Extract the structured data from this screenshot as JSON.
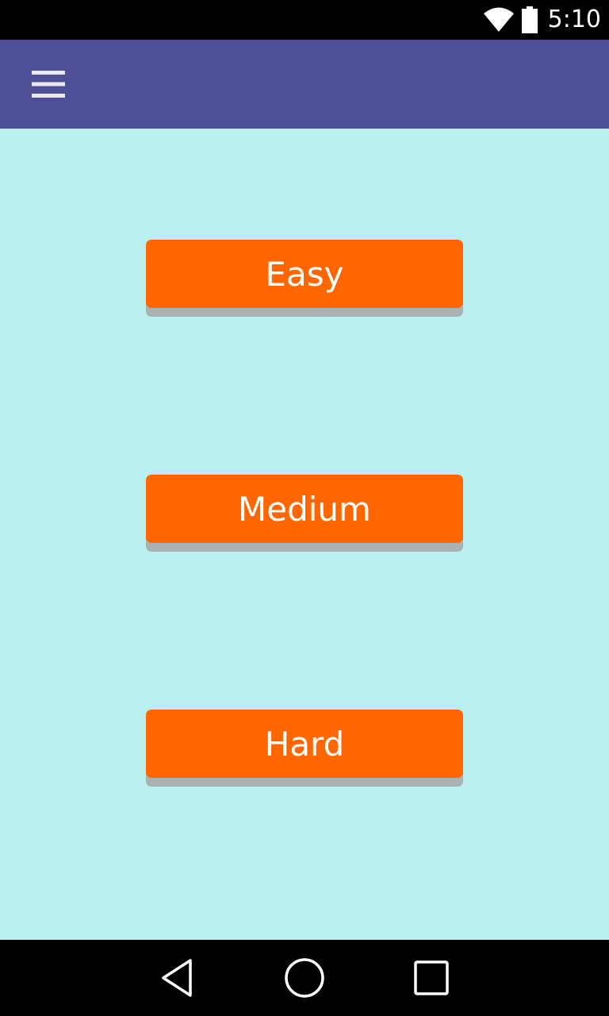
{
  "status_bar": {
    "time": "5:10",
    "icons": [
      "wifi-icon",
      "battery-icon"
    ]
  },
  "app_bar": {
    "menu_icon": "hamburger-menu-icon",
    "background": "#4f4f98"
  },
  "content": {
    "background": "#bbeeee",
    "buttons": [
      {
        "label": "Easy"
      },
      {
        "label": "Medium"
      },
      {
        "label": "Hard"
      }
    ],
    "button_color": "#ff6600"
  },
  "nav_bar": {
    "icons": [
      "back-icon",
      "home-icon",
      "recents-icon"
    ]
  }
}
